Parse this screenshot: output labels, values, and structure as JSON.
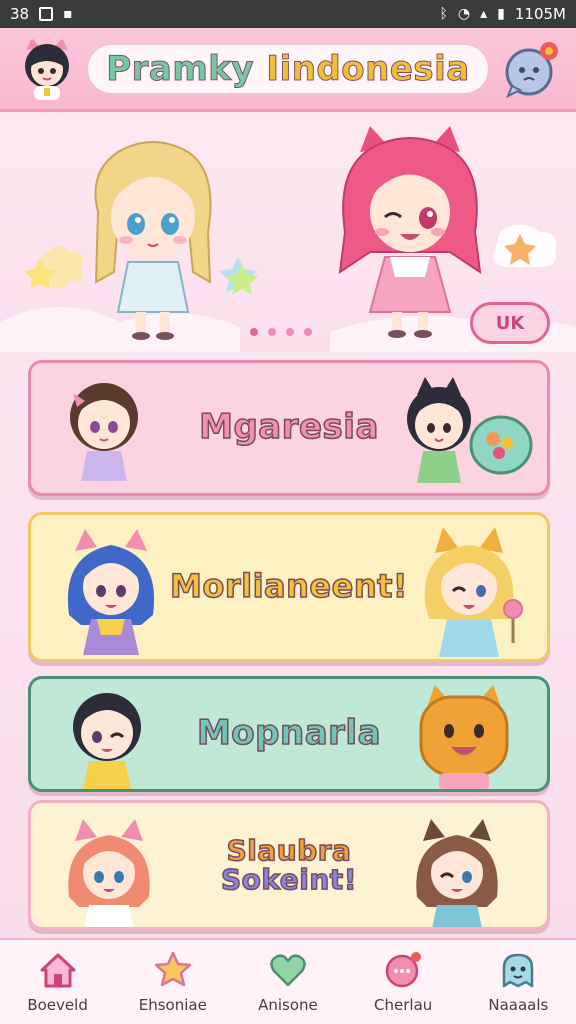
{
  "status_bar": {
    "left_text": "38",
    "time": "1105M"
  },
  "header": {
    "title_part1": "Pramky ",
    "title_part2": "Iindonesia"
  },
  "hero": {
    "region_button": "UK",
    "slides": 4,
    "active_slide": 0
  },
  "cards": [
    {
      "label": "Mgaresia"
    },
    {
      "label": "Morlianeent!"
    },
    {
      "label": "Mopnarla"
    },
    {
      "label_line1": "Slaubra",
      "label_line2": "Sokeint!"
    }
  ],
  "bottom_nav": [
    {
      "label": "Boeveld",
      "icon": "home-icon"
    },
    {
      "label": "Ehsoniae",
      "icon": "star-icon"
    },
    {
      "label": "Anisone",
      "icon": "heart-icon"
    },
    {
      "label": "Cherlau",
      "icon": "chat-bubble-icon"
    },
    {
      "label": "Naaaals",
      "icon": "mascot-icon"
    }
  ],
  "colors": {
    "accent_pink": "#e2629a",
    "header_pink": "#f8b8cf",
    "mint": "#bfe9d6",
    "butter": "#fdf1c2"
  }
}
